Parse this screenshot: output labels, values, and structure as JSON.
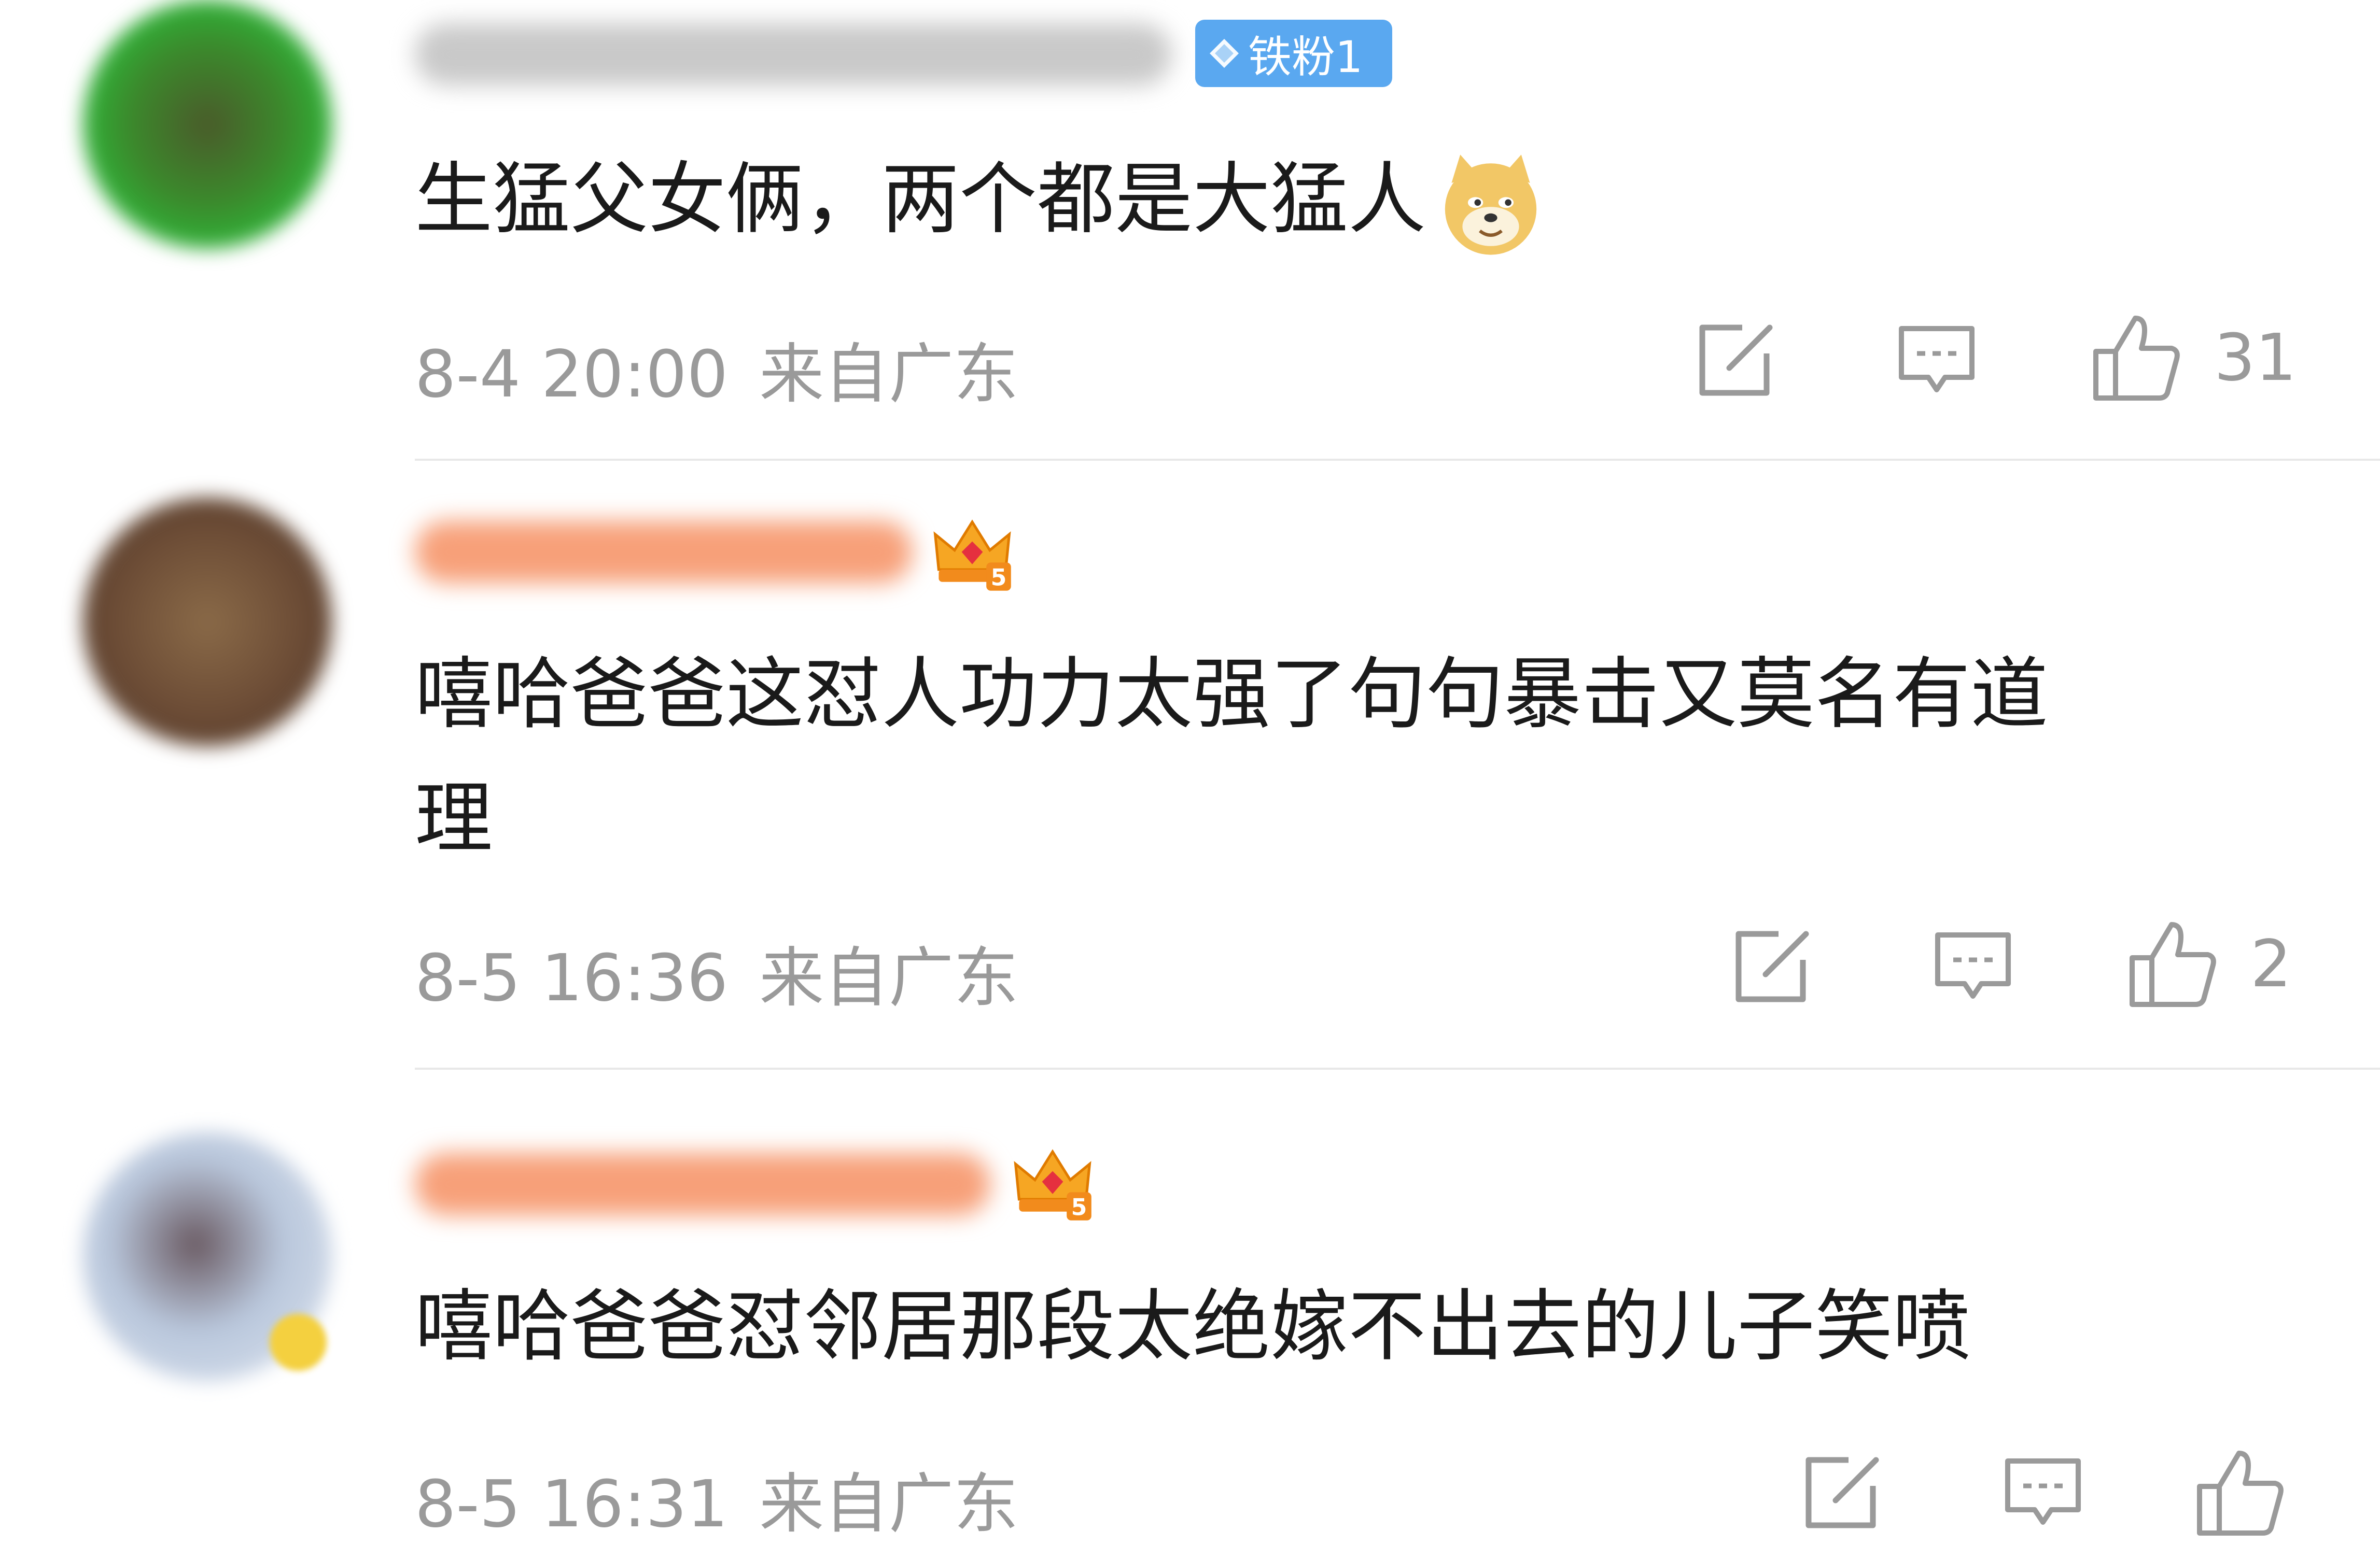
{
  "comments": [
    {
      "badge_label": "铁粉1",
      "badge_color": "#5aa8f0",
      "text": "生猛父女俩，两个都是大猛人",
      "emoji": "doge-emoji",
      "time": "8-4 20:00",
      "location": "来自广东",
      "likes": "31"
    },
    {
      "badge_label": "",
      "badge_icon": "crown-level-5-icon",
      "text_line1": "嘻哈爸爸这怼人功力太强了句句暴击又莫名有道",
      "text_line2": "理",
      "time": "8-5 16:36",
      "location": "来自广东",
      "likes": "2"
    },
    {
      "badge_icon": "crown-level-5-icon",
      "text": "嘻哈爸爸怼邻居那段太绝嫁不出去的儿子笑喷",
      "time": "8-5 16:31",
      "location": "来自广东",
      "likes": ""
    }
  ],
  "colors": {
    "text": "#1a1a1a",
    "meta": "#9a9a9a",
    "divider": "#e8e8e8",
    "fan_badge": "#5aa8f0"
  }
}
